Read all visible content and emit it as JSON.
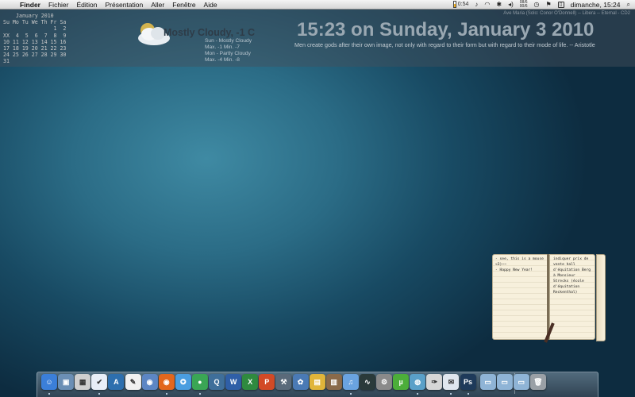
{
  "menubar": {
    "apple_icon": "",
    "items": [
      "Finder",
      "Fichier",
      "Édition",
      "Présentation",
      "Aller",
      "Fenêtre",
      "Aide"
    ],
    "battery_time": "0:54",
    "stack_top": "08/6",
    "stack_bottom": "00/6",
    "clock": "dimanche, 15:24"
  },
  "calendar": {
    "title": "January 2010",
    "rows": [
      "Su Mo Tu We Th Fr Sa",
      "                1  2",
      "XX  4  5  6  7  8  9",
      "10 11 12 13 14 15 16",
      "17 18 19 20 21 22 23",
      "24 25 26 27 28 29 30",
      "31"
    ]
  },
  "weather": {
    "main": "Mostly Cloudy, -1 C",
    "forecast": [
      "Sun - Mostly Cloudy",
      "Max. -1  Min. -7",
      "Mon - Partly Cloudy",
      "Max. -4  Min. -8"
    ]
  },
  "now_playing": "Ave Maria (Solo: Conor O'Donnell) -- Libera -- Eternal - CD2",
  "datetime": "15:23 on Sunday, January 3  2010",
  "quote": "Men create gods after their own image, not only with regard to their form but with regard to their mode of life.  -- Aristotle",
  "notebook": {
    "left_lines": [
      "- see, this is a mouse",
      "<3)~~",
      "- Happy New Year!"
    ],
    "right_lines": [
      "indiquer prix de",
      "vente hall",
      "d'équitation Berg",
      "à Monsieur",
      "Strecks (école",
      "d'équitation",
      "Reckenthal)"
    ]
  },
  "dock": {
    "items": [
      {
        "name": "finder-icon",
        "color": "#3b7fd9",
        "glyph": "☺",
        "running": true
      },
      {
        "name": "preview-icon",
        "color": "#6b8fb5",
        "glyph": "▣",
        "running": false
      },
      {
        "name": "calculator-icon",
        "color": "#cfcfcf",
        "glyph": "▦",
        "running": false
      },
      {
        "name": "ical-icon",
        "color": "#e8eef7",
        "glyph": "✔",
        "running": true
      },
      {
        "name": "dictionary-icon",
        "color": "#2d6fae",
        "glyph": "A",
        "running": false
      },
      {
        "name": "textedit-icon",
        "color": "#f1f1f1",
        "glyph": "✎",
        "running": false
      },
      {
        "name": "photo-booth-icon",
        "color": "#5c86c4",
        "glyph": "◉",
        "running": false
      },
      {
        "name": "firefox-icon",
        "color": "#e2671d",
        "glyph": "◉",
        "running": true
      },
      {
        "name": "safari-icon",
        "color": "#4a9ee0",
        "glyph": "✪",
        "running": false
      },
      {
        "name": "chrome-icon",
        "color": "#3aa655",
        "glyph": "●",
        "running": true
      },
      {
        "name": "quicktime-icon",
        "color": "#3f6f9a",
        "glyph": "Q",
        "running": false
      },
      {
        "name": "word-icon",
        "color": "#2f5fa7",
        "glyph": "W",
        "running": false
      },
      {
        "name": "excel-icon",
        "color": "#2f8a3f",
        "glyph": "X",
        "running": false
      },
      {
        "name": "powerpoint-icon",
        "color": "#d24a26",
        "glyph": "P",
        "running": false
      },
      {
        "name": "xcode-icon",
        "color": "#5a6a7a",
        "glyph": "⚒",
        "running": false
      },
      {
        "name": "iphoto-icon",
        "color": "#4a7ab5",
        "glyph": "✿",
        "running": false
      },
      {
        "name": "stickies-icon",
        "color": "#e0b53a",
        "glyph": "▤",
        "running": false
      },
      {
        "name": "photo-icon",
        "color": "#8a6a4a",
        "glyph": "▥",
        "running": false
      },
      {
        "name": "itunes-icon",
        "color": "#6aa3e0",
        "glyph": "♫",
        "running": true
      },
      {
        "name": "activity-monitor-icon",
        "color": "#2a3a3a",
        "glyph": "∿",
        "running": false
      },
      {
        "name": "system-preferences-icon",
        "color": "#8a8a8a",
        "glyph": "⚙",
        "running": false
      },
      {
        "name": "utorrent-icon",
        "color": "#4cae3a",
        "glyph": "µ",
        "running": false
      },
      {
        "name": "adium-icon",
        "color": "#5aa0c8",
        "glyph": "◍",
        "running": true
      },
      {
        "name": "script-editor-icon",
        "color": "#d6d6d6",
        "glyph": "✑",
        "running": false
      },
      {
        "name": "mail-icon",
        "color": "#dfe6ee",
        "glyph": "✉",
        "running": true
      },
      {
        "name": "photoshop-icon",
        "color": "#1e3a5a",
        "glyph": "Ps",
        "running": true
      },
      {
        "name": "applications-folder-icon",
        "color": "#8fb4d6",
        "glyph": "▭",
        "running": false
      },
      {
        "name": "documents-folder-icon",
        "color": "#8fb4d6",
        "glyph": "▭",
        "running": false
      },
      {
        "name": "downloads-folder-icon",
        "color": "#8fb4d6",
        "glyph": "▭",
        "running": false
      },
      {
        "name": "trash-icon",
        "color": "#9aa0a6",
        "glyph": "🗑",
        "running": false
      }
    ]
  }
}
